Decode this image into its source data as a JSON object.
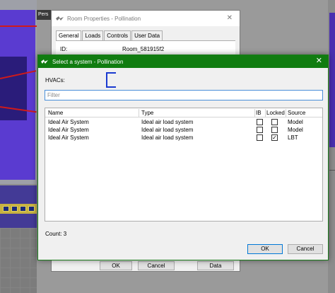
{
  "viewport": {
    "tab_label": "Pers"
  },
  "room_dialog": {
    "title": "Room Properties - Pollination",
    "tabs": [
      "General",
      "Loads",
      "Controls",
      "User Data"
    ],
    "id_label": "ID:",
    "id_value": "Room_581915f2",
    "ok_label": "OK",
    "cancel_label": "Cancel",
    "data_label": "Data"
  },
  "select_dialog": {
    "title": "Select a system - Pollination",
    "hvacs_label": "HVACs:",
    "filter_placeholder": "Filter",
    "columns": {
      "name": "Name",
      "type": "Type",
      "ib": "IB",
      "locked": "Locked",
      "source": "Source"
    },
    "rows": [
      {
        "name": "Ideal Air System",
        "type": "Ideal air load system",
        "ib": false,
        "locked": false,
        "source": "Model"
      },
      {
        "name": "Ideal Air System",
        "type": "Ideal air load system",
        "ib": false,
        "locked": false,
        "source": "Model"
      },
      {
        "name": "Ideal Air System",
        "type": "Ideal air load system",
        "ib": false,
        "locked": true,
        "source": "LBT"
      }
    ],
    "count_label": "Count: 3",
    "ok_label": "OK",
    "cancel_label": "Cancel",
    "accent_color": "#107c10"
  }
}
